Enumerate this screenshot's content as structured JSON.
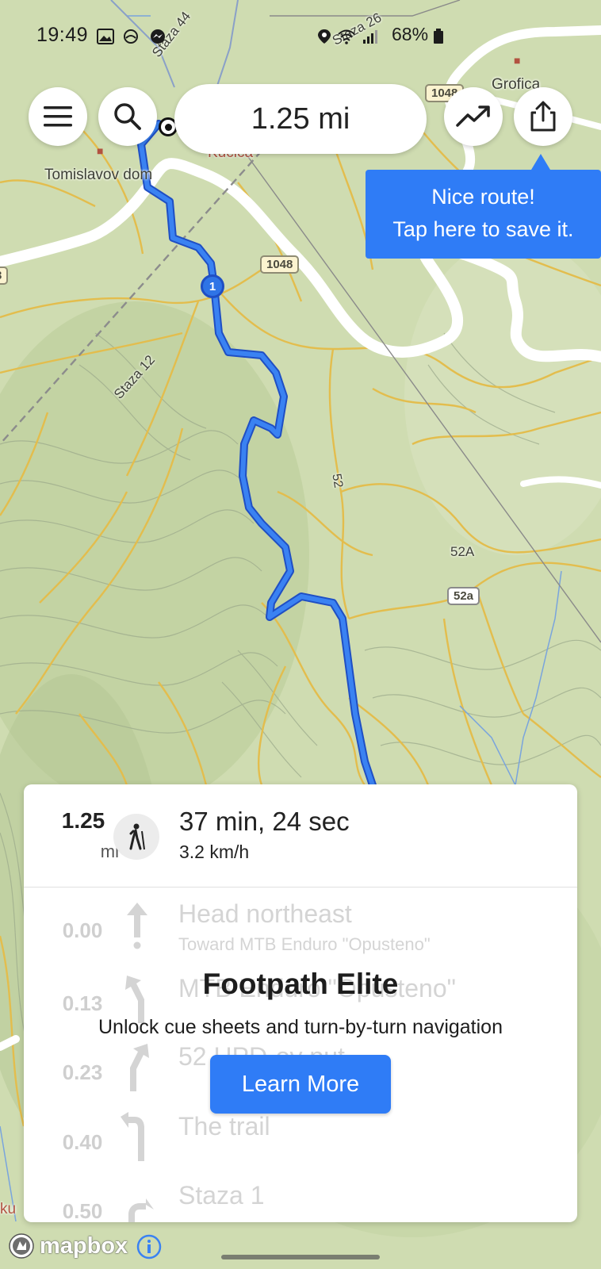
{
  "status_bar": {
    "time": "19:49",
    "battery": "68%",
    "icons": [
      "image-icon",
      "cloud-icon",
      "messenger-icon",
      "location-icon",
      "wifi-icon",
      "signal-icon",
      "battery-icon"
    ]
  },
  "map": {
    "labels": {
      "staza44": "Staza 44",
      "staza26": "Staza 26",
      "staza12": "Staza 12",
      "tomislavov": "Tomislavov dom",
      "kucica": "Kućica",
      "grofica": "Grofica",
      "ref52": "52",
      "ref52A": "52A",
      "ku_left": "ku"
    },
    "shields": {
      "r1048_top": "1048",
      "r1048": "1048",
      "r52a": "52a",
      "r3": "3"
    },
    "waypoint_number": "1",
    "colors": {
      "route": "#2f6fe0",
      "terrain": "#cfdcb1",
      "contour": "#e1b84a",
      "road": "#ffffff"
    }
  },
  "toolbar": {
    "menu_icon": "hamburger-icon",
    "search_icon": "search-icon",
    "distance": "1.25 mi",
    "elevation_icon": "trend-up-icon",
    "share_icon": "share-icon"
  },
  "tooltip": {
    "line1": "Nice route!",
    "line2": "Tap here to save it."
  },
  "summary": {
    "distance": "1.25",
    "unit": "mi",
    "mode_icon": "hiker-icon",
    "duration": "37 min, 24 sec",
    "speed": "3.2 km/h"
  },
  "cues": [
    {
      "dist": "0.00",
      "name": "Head northeast",
      "sub": "Toward MTB Enduro \"Opusteno\"",
      "icon": "arrow-up-icon"
    },
    {
      "dist": "0.13",
      "name": "MTB Enduro \"Opusteno\"",
      "sub": "",
      "icon": "bear-left-icon"
    },
    {
      "dist": "0.23",
      "name": "52 HPD-ov put",
      "sub": "",
      "icon": "bear-right-icon"
    },
    {
      "dist": "0.40",
      "name": "The trail",
      "sub": "",
      "icon": "turn-left-icon"
    },
    {
      "dist": "0.50",
      "name": "Staza 1",
      "sub": "",
      "icon": "turn-right-icon"
    }
  ],
  "upsell": {
    "title": "Footpath Elite",
    "text": "Unlock cue sheets and turn-by-turn navigation",
    "button": "Learn More"
  },
  "attribution": {
    "logo": "mapbox",
    "info_icon": "info-icon"
  }
}
